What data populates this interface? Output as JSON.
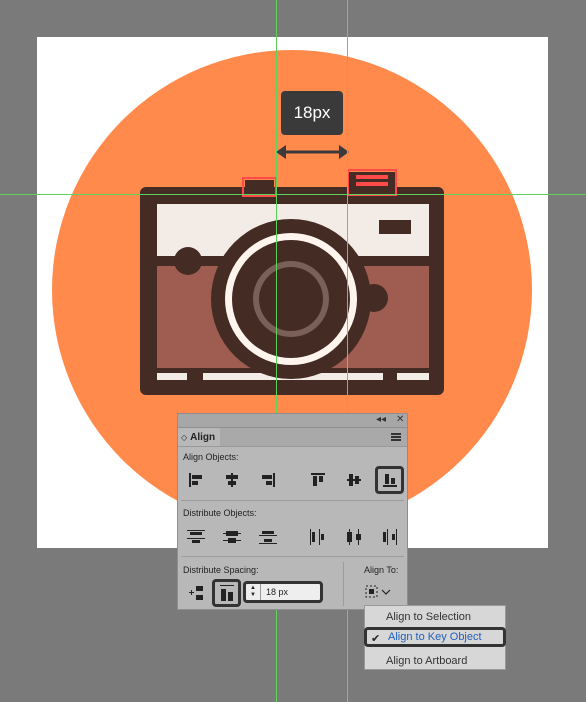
{
  "tooltip": {
    "measure": "18px"
  },
  "colors": {
    "background": "#7a7a7a",
    "artboard": "#ffffff",
    "circle": "#ff8a4c",
    "camera_dark": "#442b24",
    "camera_band": "#9e5d50",
    "camera_top": "#f3ebe6",
    "selection": "#ff4a4a",
    "guide": "#5bd35b"
  },
  "align_panel": {
    "tab_label": "Align",
    "align_objects_label": "Align Objects:",
    "distribute_objects_label": "Distribute Objects:",
    "distribute_spacing_label": "Distribute Spacing:",
    "align_to_label": "Align To:",
    "spacing_value": "18 px",
    "align_object_icons": [
      "horizontal-align-left-icon",
      "horizontal-align-center-icon",
      "horizontal-align-right-icon",
      "vertical-align-top-icon",
      "vertical-align-center-icon",
      "vertical-align-bottom-icon"
    ],
    "distribute_object_icons": [
      "vertical-distribute-top-icon",
      "vertical-distribute-center-icon",
      "vertical-distribute-bottom-icon",
      "horizontal-distribute-left-icon",
      "horizontal-distribute-center-icon",
      "horizontal-distribute-right-icon"
    ]
  },
  "align_to_menu": {
    "items": [
      "Align to Selection",
      "Align to Key Object",
      "Align to Artboard"
    ],
    "selected_index": 1
  }
}
